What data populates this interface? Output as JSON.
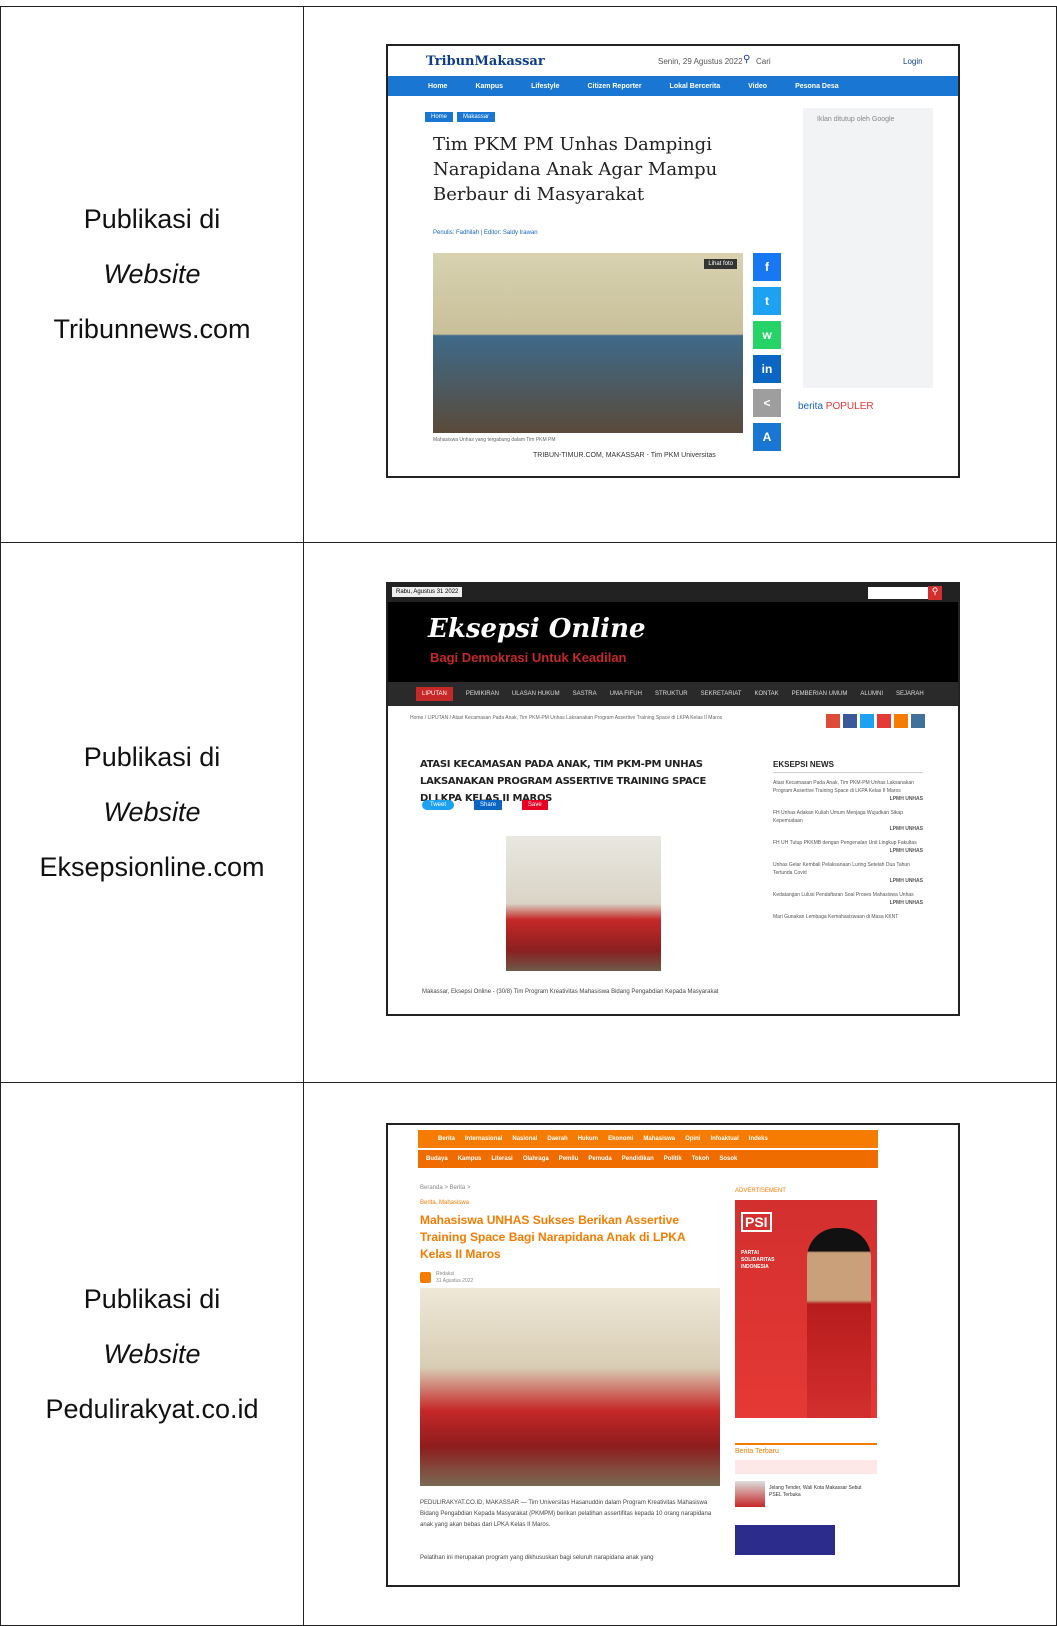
{
  "rows": [
    {
      "prefix": "Publikasi di",
      "medium": "Website",
      "site": "Tribunnews.com",
      "shot": {
        "logo": "TribunMakassar",
        "date": "Senin, 29 Agustus 2022",
        "search": "Cari",
        "login": "Login",
        "nav": [
          "Home",
          "Kampus",
          "Lifestyle",
          "Citizen Reporter",
          "Lokal Bercerita",
          "Video",
          "Pesona Desa"
        ],
        "crumbs": [
          "Home",
          "Makassar"
        ],
        "headline": "Tim PKM PM Unhas Dampingi Narapidana Anak Agar Mampu Berbaur di Masyarakat",
        "byline": "Penulis: Fadhilah | Editor: Saldy Irawan",
        "photo_tag": "Lihat foto",
        "photo_caption": "Mahasiswa Unhas yang tergabung dalam Tim PKM PM",
        "lead": "TRIBUN-TIMUR.COM, MAKASSAR - Tim PKM Universitas",
        "ad_label": "Iklan ditutup oleh Google",
        "popular_a": "berita",
        "popular_b": "POPULER",
        "share": [
          "f",
          "t",
          "w",
          "in",
          "<",
          "A"
        ]
      }
    },
    {
      "prefix": "Publikasi di",
      "medium": "Website",
      "site": "Eksepsionline.com",
      "shot": {
        "date": "Rabu, Agustus 31 2022",
        "logo": "Eksepsi Online",
        "tagline": "Bagi Demokrasi Untuk Keadilan",
        "nav": [
          "LIPUTAN",
          "PEMIKIRAN",
          "ULASAN HUKUM",
          "SASTRA",
          "UMA FIFUH",
          "STRUKTUR",
          "SEKRETARIAT",
          "KONTAK",
          "PEMBERIAN UMUM",
          "ALUMNI",
          "SEJARAH"
        ],
        "breadcrumb": "Home / LIPUTAN / Atasi Kecamasan Pada Anak, Tim PKM-PM Unhas Laksanakan Program Assertive Training Space di LKPA Kelas II Maros",
        "headline": "ATASI KECAMASAN PADA ANAK, TIM PKM-PM UNHAS LAKSANAKAN PROGRAM ASSERTIVE TRAINING SPACE DI LKPA KELAS II MAROS",
        "buttons": [
          "Tweet",
          "Share",
          "Save"
        ],
        "lead": "Makassar, Eksepsi Online - (30/8) Tim Program Kreativitas Mahasiswa Bidang Pengabdian Kepada Masyarakat",
        "sidebar_title": "EKSEPSI NEWS",
        "sidebar_items": [
          "Atasi Kecamasan Pada Anak, Tim PKM-PM Unhas Laksanakan Program Assertive Training Space di LKPA Kelas II Maros",
          "FH Unhas Adakan Kuliah Umum Menjaga Wujudkan Sikap Kepemudaan",
          "FH UH Tutup PKKMB dengan Pengenalan Unit Lingkup Fakultas",
          "Unhas Gelar Kembali Pelaksanaan Luring Setelah Dua Tahun Tertunda Covid",
          "Kedatangan Lulusi Pendaftaran Soal Proses Mahasiswa Unhas",
          "Mari Gunakan Lembaga Kemahasiswaan di Masa KKNT"
        ],
        "sidebar_tag": "LPMH UNHAS"
      }
    },
    {
      "prefix": "Publikasi di",
      "medium": "Website",
      "site": "Pedulirakyat.co.id",
      "shot": {
        "nav1": [
          "Berita",
          "Internasional",
          "Nasional",
          "Daerah",
          "Hukum",
          "Ekonomi",
          "Mahasiswa",
          "Opini",
          "Infoaktual",
          "Indeks"
        ],
        "nav2": [
          "Budaya",
          "Kampus",
          "Literasi",
          "Olahraga",
          "Pemilu",
          "Pemuda",
          "Pendidikan",
          "Politik",
          "Tokoh",
          "Sosok"
        ],
        "crumbs": "Beranda > Berita >",
        "category": "Berita, Mahasiswa",
        "headline": "Mahasiswa UNHAS Sukses Berikan Assertive Training Space Bagi Narapidana Anak di LPKA Kelas II Maros",
        "author": "Redaksi",
        "date": "31 Agustus 2022",
        "ad_label": "ADVERTISEMENT",
        "ad_text": "PSI",
        "ad_sub": "PARTAI SOLIDARITAS INDONESIA",
        "latest": "Berita Terbaru",
        "latest_item": "Jelang Tender, Wali Kota Makassar Sebut PSEL Terbuka",
        "lead": "PEDULIRAKYAT.CO.ID, MAKASSAR — Tim Universitas Hasanuddin dalam Program Kreativitas Mahasiswa Bidang Pengabdian Kepada Masyarakat (PKMPM) berikan pelatihan assertifitas kepada 10 orang narapidana anak yang akan bebas dari LPKA Kelas II Maros.",
        "lead2": "Pelatihan ini merupakan program yang dikhususkan bagi seluruh narapidana anak yang"
      }
    }
  ]
}
